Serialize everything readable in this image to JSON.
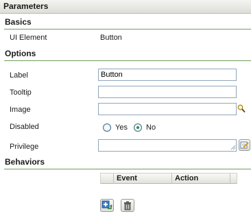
{
  "panel": {
    "title": "Parameters"
  },
  "basics": {
    "heading": "Basics",
    "ui_element_label": "UI Element",
    "ui_element_value": "Button"
  },
  "options": {
    "heading": "Options",
    "label_label": "Label",
    "label_value": "Button",
    "tooltip_label": "Tooltip",
    "tooltip_value": "",
    "image_label": "Image",
    "image_value": "",
    "disabled_label": "Disabled",
    "disabled_yes": "Yes",
    "disabled_no": "No",
    "disabled_selected": "No",
    "privilege_label": "Privilege",
    "privilege_value": ""
  },
  "behaviors": {
    "heading": "Behaviors",
    "columns": [
      "Event",
      "Action"
    ]
  },
  "icons": {
    "image_search": "magnifier-icon",
    "privilege_edit": "edit-icon",
    "add_behavior": "add-behavior-icon",
    "delete_behavior": "trash-icon"
  }
}
